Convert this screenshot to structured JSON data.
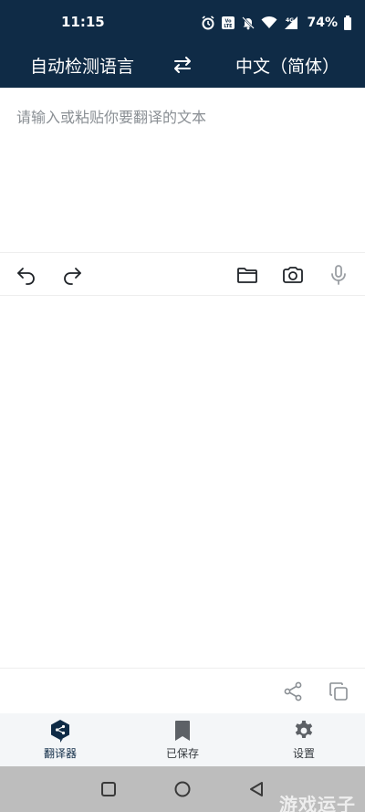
{
  "status_bar": {
    "time": "11:15",
    "battery_percent": "74%",
    "icons": [
      "alarm-icon",
      "volte-icon",
      "mute-icon",
      "wifi-icon",
      "signal-4g-icon",
      "battery-icon"
    ]
  },
  "language_bar": {
    "source_language": "自动检测语言",
    "target_language": "中文（简体）",
    "swap_icon": "swap-icon"
  },
  "input": {
    "placeholder": "请输入或粘贴你要翻译的文本"
  },
  "toolbar": {
    "left_icons": [
      "undo-icon",
      "redo-icon"
    ],
    "right_icons": [
      "folder-icon",
      "camera-icon",
      "microphone-icon"
    ]
  },
  "output_actions": [
    "share-icon",
    "copy-icon"
  ],
  "tabs": [
    {
      "label": "翻译器",
      "icon": "deepl-logo-icon",
      "active": true
    },
    {
      "label": "已保存",
      "icon": "bookmark-icon",
      "active": false
    },
    {
      "label": "设置",
      "icon": "gear-icon",
      "active": false
    }
  ],
  "system_nav": {
    "buttons": [
      "recents-button",
      "home-button",
      "back-button"
    ]
  },
  "watermark": "游戏运子",
  "colors": {
    "header_bg": "#0f2b46",
    "tabbar_bg": "#f4f6f8",
    "navbar_bg": "#bdbdbd",
    "placeholder_text": "#8a8f94",
    "icon_gray": "#6b7075"
  }
}
